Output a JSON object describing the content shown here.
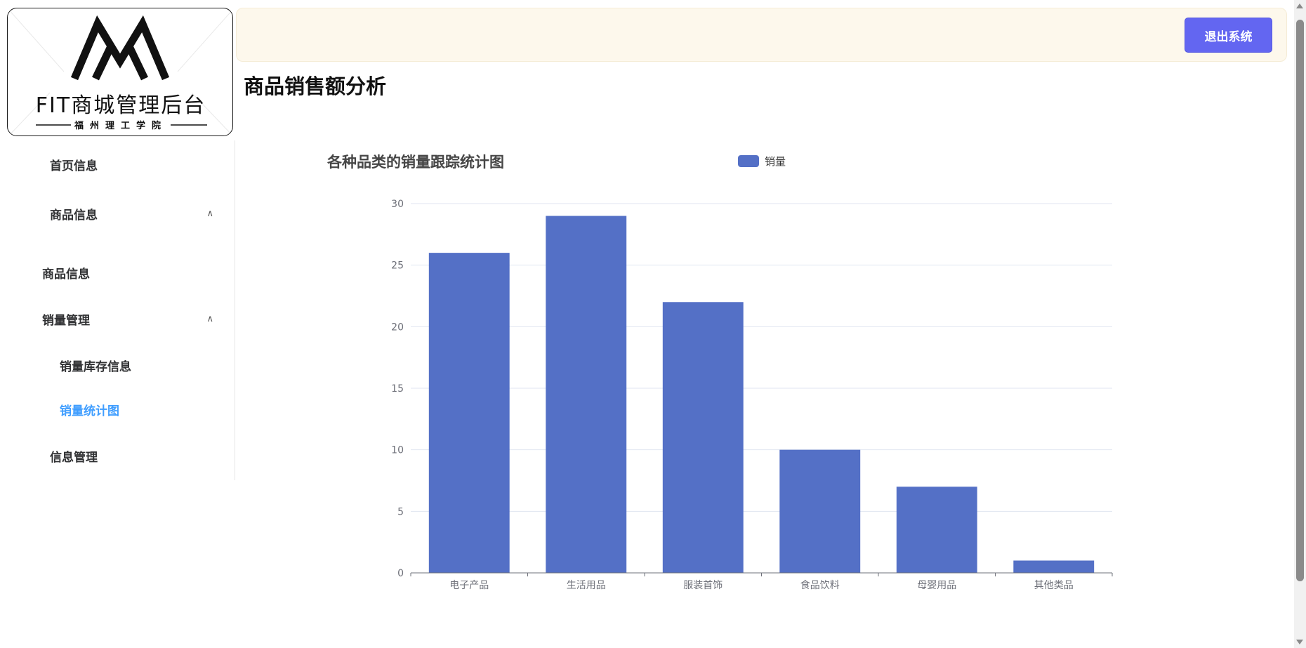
{
  "logo": {
    "title": "FIT商城管理后台",
    "subtitle": "福州理工学院"
  },
  "header": {
    "logout_label": "退出系统"
  },
  "page": {
    "title": "商品销售额分析"
  },
  "sidebar": {
    "items": [
      {
        "label": "首页信息",
        "arrow": ""
      },
      {
        "label": "商品信息",
        "arrow": "^"
      },
      {
        "label": "商品信息",
        "arrow": ""
      },
      {
        "label": "销量管理",
        "arrow": "^"
      },
      {
        "label": "销量库存信息",
        "arrow": ""
      },
      {
        "label": "销量统计图",
        "arrow": "",
        "active": true
      },
      {
        "label": "信息管理",
        "arrow": ""
      }
    ]
  },
  "colors": {
    "bar": "#5470c6",
    "active_menu": "#409eff",
    "logout_button": "#6366f1",
    "header_bg": "#fdf8ec"
  },
  "chart_data": {
    "type": "bar",
    "title": "各种品类的销量跟踪统计图",
    "legend": [
      "销量"
    ],
    "legend_position": "top-center",
    "categories": [
      "电子产品",
      "生活用品",
      "服装首饰",
      "食品饮料",
      "母婴用品",
      "其他类品"
    ],
    "series": [
      {
        "name": "销量",
        "values": [
          26,
          29,
          22,
          10,
          7,
          1
        ]
      }
    ],
    "ylim": [
      0,
      30
    ],
    "yticks": [
      0,
      5,
      10,
      15,
      20,
      25,
      30
    ],
    "grid": true
  }
}
